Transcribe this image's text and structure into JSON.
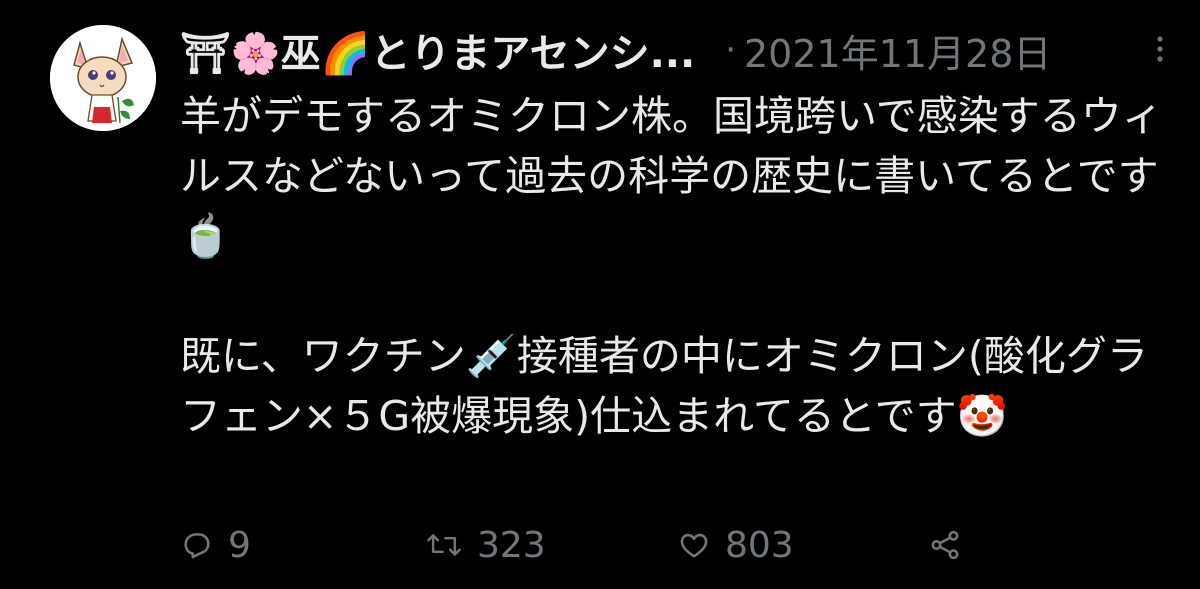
{
  "tweet": {
    "display_name": "⛩🌸巫🌈とりまアセンシ...",
    "separator": "·",
    "timestamp": "2021年11月28日",
    "body": "羊がデモするオミクロン株。国境跨いで感染するウィルスなどないって過去の科学の歴史に書いてるとです🍵\n\n既に、ワクチン💉接種者の中にオミクロン(酸化グラフェン×５G被爆現象)仕込まれてるとです🤡",
    "reply_count": "9",
    "retweet_count": "323",
    "like_count": "803"
  },
  "icons": {
    "avatar": "avatar-cartoon-fox",
    "more": "more-icon",
    "reply": "reply-icon",
    "retweet": "retweet-icon",
    "like": "like-icon",
    "share": "share-icon"
  },
  "colors": {
    "background": "#000000",
    "text": "#e7e9ea",
    "secondary": "#71767b"
  }
}
